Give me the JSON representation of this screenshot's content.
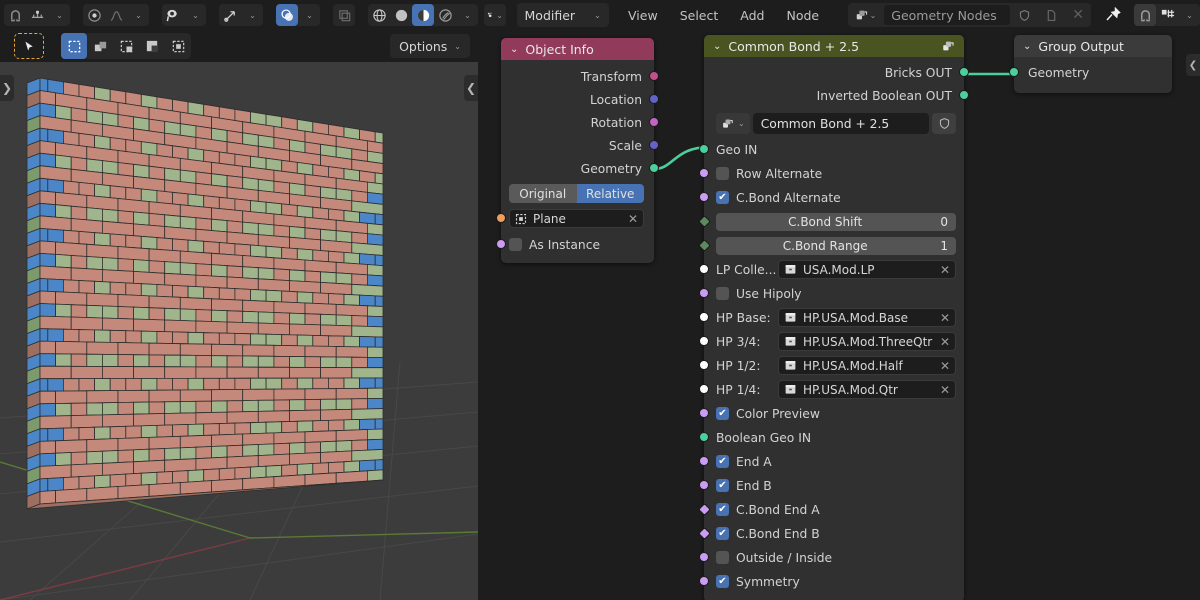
{
  "viewport": {
    "header_icons": [
      "snap-magnet-icon",
      "snap-increment-icon",
      "proportional-edit-icon",
      "falloff-curve-icon",
      "visibility-eye-icon",
      "show-gizmo-icon",
      "overlays-icon",
      "xray-toggle-icon",
      "viewport-wireframe-icon",
      "viewport-solid-icon",
      "viewport-material-icon",
      "viewport-rendered-icon"
    ],
    "select_modes": [
      "select-box",
      "select-extend",
      "select-subtract",
      "select-invert",
      "select-intersect"
    ],
    "cursor_tool": "tweak-tool",
    "options_label": "Options",
    "left_edge_arrow": "❯",
    "right_edge_arrow": "❮"
  },
  "node_editor": {
    "editor_type_icon": "geometry-nodes-editor-icon",
    "mode_dropdown": "Modifier",
    "menus": [
      "View",
      "Select",
      "Add",
      "Node"
    ],
    "id_block": {
      "browse_icon": "browse-nodetree-icon",
      "name": "Geometry Nodes",
      "shield_icon": "fake-user-icon",
      "copy_icon": "new-copy-icon",
      "unlink_icon": "unlink-icon"
    },
    "pin_icon": "pin-icon",
    "snap_icon": "snap-magnet-icon",
    "overlay_icon": "node-overlays-icon",
    "overlay_caret": "⌄",
    "right_edge_arrow": "❮"
  },
  "nodes": {
    "object_info": {
      "title": "Object Info",
      "header_color": "#923a5a",
      "collapse_icon": "chevron-down-icon",
      "outputs": [
        {
          "label": "Transform",
          "color": "#c2518a"
        },
        {
          "label": "Location",
          "color": "#6363c7"
        },
        {
          "label": "Rotation",
          "color": "#c165c1"
        },
        {
          "label": "Scale",
          "color": "#6363c7"
        },
        {
          "label": "Geometry",
          "color": "#4ccf9c"
        }
      ],
      "transform_space": {
        "options": [
          "Original",
          "Relative"
        ],
        "selected": "Relative"
      },
      "object_field": {
        "icon": "object-data-icon",
        "value": "Plane",
        "clear_icon": "x-icon",
        "socket_color": "#ed9e5c"
      },
      "as_instance": {
        "label": "As Instance",
        "checked": false,
        "socket_color": "#cb9cf2"
      }
    },
    "common_bond": {
      "title": "Common Bond + 2.5",
      "header_color": "#4a5420",
      "collapse_icon": "chevron-down-icon",
      "group_icon": "node-group-icon",
      "outputs": [
        {
          "label": "Bricks OUT",
          "color": "#4ccf9c"
        },
        {
          "label": "Inverted Boolean OUT",
          "color": "#4ccf9c"
        }
      ],
      "group_selector": {
        "browse_icon": "browse-nodegroup-icon",
        "caret": "⌄",
        "value": "Common Bond + 2.5",
        "shield_icon": "fake-user-icon"
      },
      "inputs": [
        {
          "type": "socket-only",
          "label": "Geo IN",
          "socket": "#4ccf9c"
        },
        {
          "type": "checkbox",
          "label": "Row Alternate",
          "checked": false,
          "socket": "#cb9cf2"
        },
        {
          "type": "checkbox",
          "label": "C.Bond Alternate",
          "checked": true,
          "socket": "#cb9cf2"
        },
        {
          "type": "value",
          "label": "C.Bond Shift",
          "value": "0",
          "socket": "#5d8a5d",
          "shape": "diamond"
        },
        {
          "type": "value",
          "label": "C.Bond Range",
          "value": "1",
          "socket": "#5d8a5d",
          "shape": "diamond"
        },
        {
          "type": "id",
          "label": "LP Colle...",
          "value": "USA.Mod.LP",
          "icon": "collection-icon",
          "clear_icon": "x-icon",
          "socket": "#ffffff"
        },
        {
          "type": "checkbox",
          "label": "Use Hipoly",
          "checked": false,
          "socket": "#cb9cf2"
        },
        {
          "type": "id",
          "label": "HP Base:",
          "value": "HP.USA.Mod.Base",
          "icon": "collection-icon",
          "clear_icon": "x-icon",
          "socket": "#ffffff"
        },
        {
          "type": "id",
          "label": "HP 3/4:",
          "value": "HP.USA.Mod.ThreeQtr",
          "icon": "collection-icon",
          "clear_icon": "x-icon",
          "socket": "#ffffff"
        },
        {
          "type": "id",
          "label": "HP 1/2:",
          "value": "HP.USA.Mod.Half",
          "icon": "collection-icon",
          "clear_icon": "x-icon",
          "socket": "#ffffff"
        },
        {
          "type": "id",
          "label": "HP 1/4:",
          "value": "HP.USA.Mod.Qtr",
          "icon": "collection-icon",
          "clear_icon": "x-icon",
          "socket": "#ffffff"
        },
        {
          "type": "checkbox",
          "label": "Color Preview",
          "checked": true,
          "socket": "#cb9cf2"
        },
        {
          "type": "socket-only",
          "label": "Boolean Geo IN",
          "socket": "#4ccf9c"
        },
        {
          "type": "checkbox",
          "label": "End A",
          "checked": true,
          "socket": "#cb9cf2"
        },
        {
          "type": "checkbox",
          "label": "End B",
          "checked": true,
          "socket": "#cb9cf2"
        },
        {
          "type": "checkbox",
          "label": "C.Bond End A",
          "checked": true,
          "socket": "#cb9cf2",
          "shape": "diamond"
        },
        {
          "type": "checkbox",
          "label": "C.Bond End B",
          "checked": true,
          "socket": "#cb9cf2",
          "shape": "diamond"
        },
        {
          "type": "checkbox",
          "label": "Outside / Inside",
          "checked": false,
          "socket": "#cb9cf2"
        },
        {
          "type": "checkbox",
          "label": "Symmetry",
          "checked": true,
          "socket": "#cb9cf2"
        }
      ]
    },
    "group_output": {
      "title": "Group Output",
      "header_color": "#3b3b3b",
      "collapse_icon": "chevron-down-icon",
      "inputs": [
        {
          "label": "Geometry",
          "color": "#4ccf9c"
        }
      ]
    }
  },
  "links": [
    {
      "from": "object_info.Geometry",
      "to": "common_bond.Geo IN",
      "color": "#4ccf9c"
    },
    {
      "from": "common_bond.Bricks OUT",
      "to": "group_output.Geometry",
      "color": "#4ccf9c"
    }
  ],
  "scene": {
    "object": "brick-wall",
    "brick_colors": {
      "stretcher": "#c4897a",
      "header": "#a0b58c",
      "blue": "#4a86c8",
      "side_dark": "#9c6f60",
      "side_green": "#7d9a6d"
    },
    "axis_x_color": "#7c3b43",
    "axis_y_color": "#5a7a35",
    "background": "#3c3c3c"
  }
}
